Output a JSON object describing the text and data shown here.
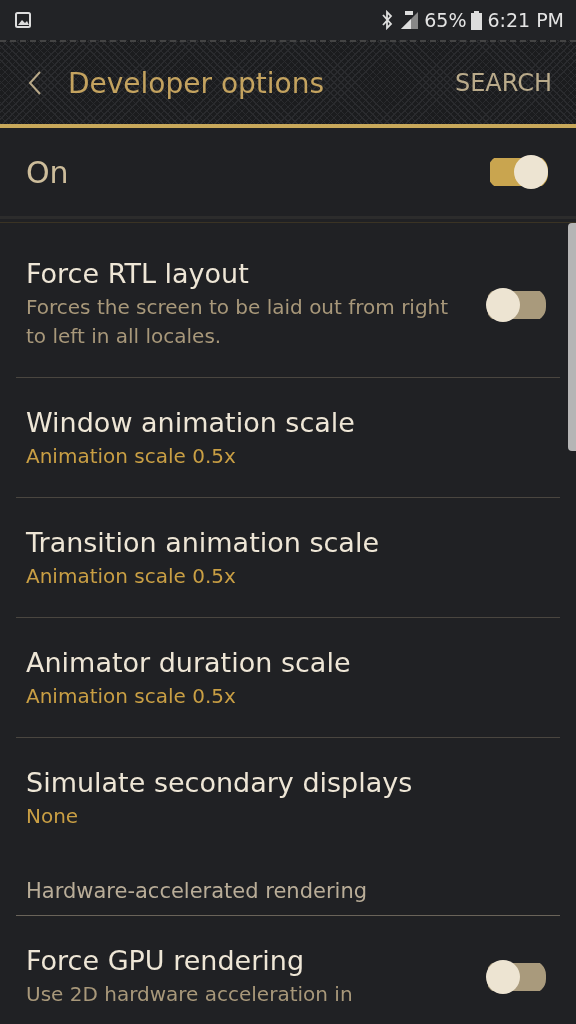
{
  "status_bar": {
    "battery": "65%",
    "time": "6:21 PM"
  },
  "header": {
    "title": "Developer options",
    "action": "SEARCH"
  },
  "master": {
    "label": "On",
    "on": true
  },
  "items": [
    {
      "kind": "toggle",
      "title": "Force RTL layout",
      "summary": "Forces the screen to be laid out from right to left in all locales.",
      "on": false
    },
    {
      "kind": "value",
      "title": "Window animation scale",
      "summary": "Animation scale 0.5x"
    },
    {
      "kind": "value",
      "title": "Transition animation scale",
      "summary": "Animation scale 0.5x"
    },
    {
      "kind": "value",
      "title": "Animator duration scale",
      "summary": "Animation scale 0.5x"
    },
    {
      "kind": "value",
      "title": "Simulate secondary displays",
      "summary": "None"
    },
    {
      "kind": "section",
      "title": "Hardware-accelerated rendering"
    },
    {
      "kind": "toggle",
      "title": "Force GPU rendering",
      "summary": "Use 2D hardware acceleration in",
      "on": false
    }
  ]
}
